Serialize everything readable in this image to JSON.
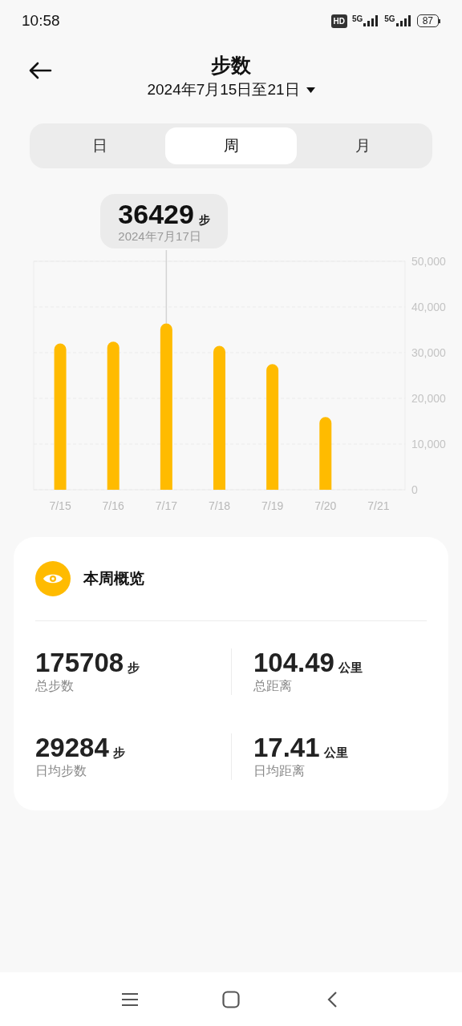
{
  "status_bar": {
    "time": "10:58",
    "hd_badge": "HD",
    "networks": [
      "5G",
      "5G"
    ],
    "battery": "87"
  },
  "header": {
    "title": "步数",
    "date_range": "2024年7月15日至21日"
  },
  "tabs": [
    {
      "label": "日",
      "selected": false
    },
    {
      "label": "周",
      "selected": true
    },
    {
      "label": "月",
      "selected": false
    }
  ],
  "chart": {
    "tooltip": {
      "value": "36429",
      "unit": "步",
      "date": "2024年7月17日"
    },
    "chart_data": {
      "type": "bar",
      "categories": [
        "7/15",
        "7/16",
        "7/17",
        "7/18",
        "7/19",
        "7/20",
        "7/21"
      ],
      "series": [
        {
          "color": "#ffbb00",
          "values": [
            32000,
            32400,
            36400,
            31500,
            27500,
            15900,
            null
          ]
        }
      ],
      "ylim": [
        0,
        50000
      ],
      "grid": true,
      "yticks": [
        {
          "value": 0,
          "label": "0"
        },
        {
          "value": 10000,
          "label": "10,000"
        },
        {
          "value": 20000,
          "label": "20,000"
        },
        {
          "value": 30000,
          "label": "30,000"
        },
        {
          "value": 40000,
          "label": "40,000"
        },
        {
          "value": 50000,
          "label": "50,000"
        }
      ]
    }
  },
  "overview": {
    "title": "本周概览",
    "stats": [
      {
        "value": "175708",
        "unit": "步",
        "label": "总步数"
      },
      {
        "value": "104.49",
        "unit": "公里",
        "label": "总距离"
      },
      {
        "value": "29284",
        "unit": "步",
        "label": "日均步数"
      },
      {
        "value": "17.41",
        "unit": "公里",
        "label": "日均距离"
      }
    ]
  }
}
